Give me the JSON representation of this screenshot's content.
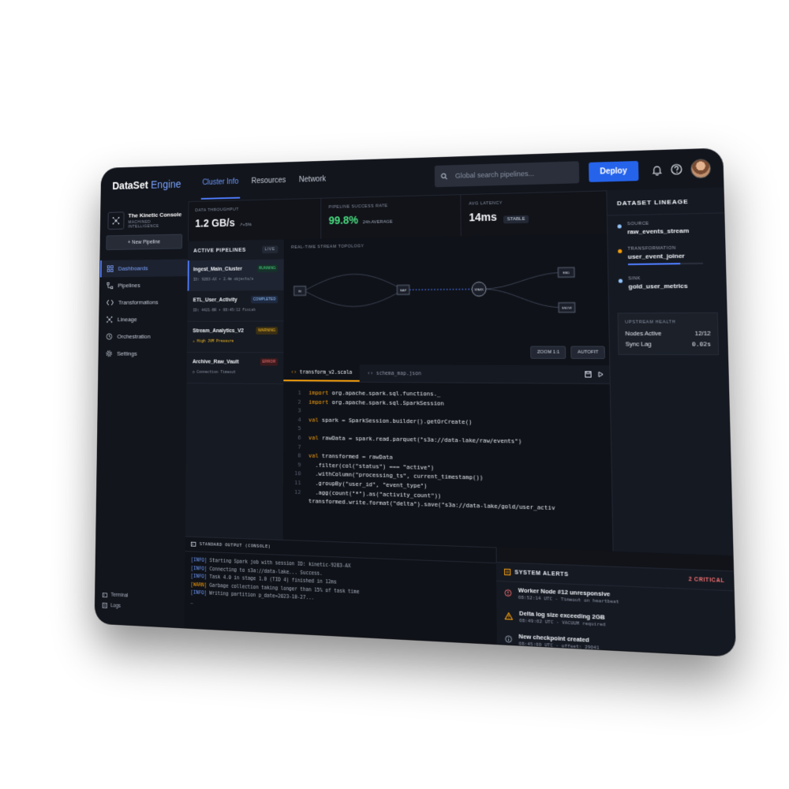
{
  "app": {
    "brand": "DataSet",
    "brand_suffix": "Engine"
  },
  "header": {
    "tabs": [
      {
        "label": "Cluster Info"
      },
      {
        "label": "Resources"
      },
      {
        "label": "Network"
      }
    ],
    "search_placeholder": "Global search pipelines...",
    "deploy_label": "Deploy"
  },
  "workspace": {
    "name": "The Kinetic Console",
    "subtitle": "MACHINED INTELLIGENCE",
    "new_pipeline_label": "+ New Pipeline"
  },
  "nav": [
    {
      "label": "Dashboards",
      "icon": "grid-icon"
    },
    {
      "label": "Pipelines",
      "icon": "pipeline-icon"
    },
    {
      "label": "Transformations",
      "icon": "code-icon"
    },
    {
      "label": "Lineage",
      "icon": "lineage-icon"
    },
    {
      "label": "Orchestration",
      "icon": "clock-icon"
    },
    {
      "label": "Settings",
      "icon": "gear-icon"
    }
  ],
  "sidebar_footer": {
    "terminal": "Terminal",
    "logs": "Logs"
  },
  "kpis": [
    {
      "label": "DATA THROUGHPUT",
      "value": "1.2 GB/s",
      "sub": "↗+5%"
    },
    {
      "label": "PIPELINE SUCCESS RATE",
      "value": "99.8%",
      "sub": "24h AVERAGE"
    },
    {
      "label": "AVG LATENCY",
      "value": "14ms",
      "badge": "STABLE"
    }
  ],
  "pipelines": {
    "title": "ACTIVE PIPELINES",
    "live": "LIVE",
    "items": [
      {
        "name": "Ingest_Main_Cluster",
        "status": "RUNNING",
        "meta": "ID: 9283-AX • 2.4m objects/s"
      },
      {
        "name": "ETL_User_Activity",
        "status": "COMPLETED",
        "meta": "ID: 4421-BR • 08:45:12 Finish"
      },
      {
        "name": "Stream_Analytics_V2",
        "status": "WARNING",
        "meta": "⚠ High JVM Pressure"
      },
      {
        "name": "Archive_Raw_Vault",
        "status": "ERROR",
        "meta": "◷ Connection Timeout"
      }
    ]
  },
  "topology": {
    "title": "REAL-TIME STREAM TOPOLOGY",
    "nodes": {
      "in": "IN",
      "map": "MAP",
      "spark": "SPARK",
      "red": "RED",
      "snow": "SNOW"
    },
    "zoom_label": "ZOOM 1:1",
    "autofit_label": "AUTOFIT"
  },
  "editor": {
    "tabs": [
      {
        "label": "transform_v2.scala"
      },
      {
        "label": "schema_map.json"
      }
    ],
    "lines": [
      {
        "n": "1",
        "kw": "import",
        "rest": " org.apache.spark.sql.functions._"
      },
      {
        "n": "2",
        "kw": "import",
        "rest": " org.apache.spark.sql.SparkSession"
      },
      {
        "n": "3",
        "kw": "",
        "rest": ""
      },
      {
        "n": "4",
        "kw": "val",
        "rest": " spark = SparkSession.builder().getOrCreate()"
      },
      {
        "n": "5",
        "kw": "",
        "rest": ""
      },
      {
        "n": "6",
        "kw": "val",
        "rest": " rawData = spark.read.parquet(\"s3a://data-lake/raw/events\")"
      },
      {
        "n": "7",
        "kw": "",
        "rest": ""
      },
      {
        "n": "8",
        "kw": "val",
        "rest": " transformed = rawData"
      },
      {
        "n": "9",
        "kw": "",
        "rest": "  .filter(col(\"status\") === \"active\")"
      },
      {
        "n": "10",
        "kw": "",
        "rest": "  .withColumn(\"processing_ts\", current_timestamp())"
      },
      {
        "n": "11",
        "kw": "",
        "rest": "  .groupBy(\"user_id\", \"event_type\")"
      },
      {
        "n": "12",
        "kw": "",
        "rest": "  .agg(count(\"*\").as(\"activity_count\"))"
      },
      {
        "n": "",
        "kw": "",
        "rest": ""
      },
      {
        "n": "",
        "kw": "",
        "rest": "transformed.write.format(\"delta\").save(\"s3a://data-lake/gold/user_activ"
      }
    ]
  },
  "lineage": {
    "title": "DATASET LINEAGE",
    "nodes": [
      {
        "kind": "SOURCE",
        "name": "raw_events_stream",
        "color": "#93c5fd"
      },
      {
        "kind": "TRANSFORMATION",
        "name": "user_event_joiner",
        "color": "#f59e0b",
        "progress": 0.7
      },
      {
        "kind": "SINK",
        "name": "gold_user_metrics",
        "color": "#93c5fd"
      }
    ],
    "health": {
      "title": "UPSTREAM HEALTH",
      "nodes_label": "Nodes Active",
      "nodes_value": "12/12",
      "sync_label": "Sync Lag",
      "sync_value": "0.02s"
    }
  },
  "console": {
    "title": "STANDARD OUTPUT (CONSOLE)",
    "lines": [
      {
        "tag": "[INFO]",
        "text": " Starting Spark job with session ID: kinetic-9283-AX"
      },
      {
        "tag": "[INFO]",
        "text": " Connecting to s3a://data-lake... Success."
      },
      {
        "tag": "[INFO]",
        "text": " Task 4.0 in stage 1.0 (TID 4) finished in 12ms"
      },
      {
        "tag": "[WARN]",
        "text": " Garbage collection taking longer than 15% of task time"
      },
      {
        "tag": "[INFO]",
        "text": " Writing partition p_date=2023-10-27..."
      }
    ],
    "prompt": "_"
  },
  "alerts": {
    "title": "SYSTEM ALERTS",
    "count": "2 CRITICAL",
    "items": [
      {
        "title": "Worker Node #12 unresponsive",
        "meta": "08:52:14 UTC · Timeout on heartbeat",
        "icon": "error-icon",
        "color": "#f87171"
      },
      {
        "title": "Delta log size exceeding 2GB",
        "meta": "08:49:02 UTC · VACUUM required",
        "icon": "warning-icon",
        "color": "#f59e0b"
      },
      {
        "title": "New checkpoint created",
        "meta": "08:45:00 UTC · offset: 29041",
        "icon": "info-icon",
        "color": "#9aa2b1"
      }
    ]
  }
}
